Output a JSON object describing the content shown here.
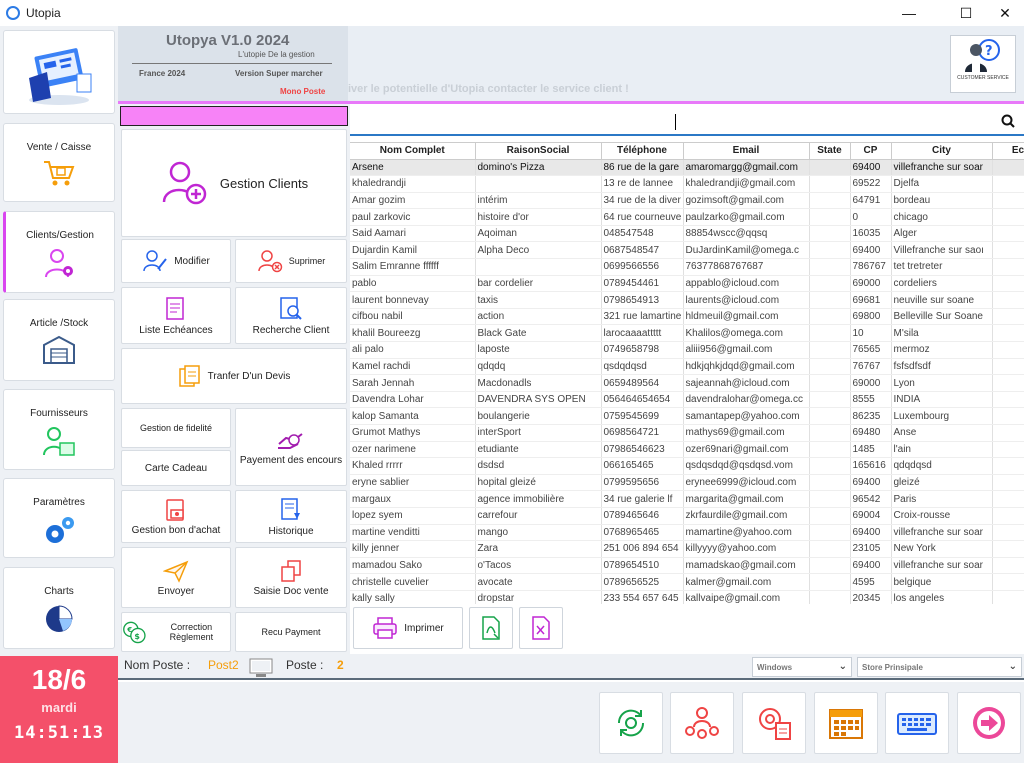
{
  "window": {
    "title": "Utopia",
    "min": "—",
    "max": "☐",
    "close": "✕"
  },
  "sidebar": {
    "items": [
      {
        "label": "Vente / Caisse"
      },
      {
        "label": "Clients/Gestion"
      },
      {
        "label": "Article /Stock"
      },
      {
        "label": "Fournisseurs"
      },
      {
        "label": "Paramètres"
      },
      {
        "label": "Charts"
      }
    ]
  },
  "datebox": {
    "date": "18/6",
    "weekday": "mardi",
    "time": "14:51:13"
  },
  "brand": {
    "name": "Utopya V1.0 2024",
    "tagline": "L'utopie De la gestion",
    "country": "France 2024",
    "version": "Version Super marcher",
    "mode": "Mono Poste"
  },
  "marquee": "iver le potentielle d'Utopia contacter le service client !",
  "support": {
    "label": "CUSTOMER SERVICE"
  },
  "actions": {
    "gestion_clients": "Gestion Clients",
    "modifier": "Modifier",
    "supprimer": "Suprimer",
    "liste_echeances": "Liste Echéances",
    "recherche_client": "Recherche Client",
    "transfer_devis": "Tranfer D'un Devis",
    "gestion_fidelite": "Gestion de fidelité",
    "carte_cadeau": "Carte Cadeau",
    "payement_encours": "Payement des encours",
    "gestion_bon_achat": "Gestion bon d'achat",
    "historique": "Historique",
    "envoyer": "Envoyer",
    "saisie_doc_vente": "Saisie Doc vente",
    "correction_reglement": "Correction Règlement",
    "recu_payment": "Recu Payment"
  },
  "table": {
    "columns": [
      "Nom Complet",
      "RaisonSocial",
      "Téléphone",
      "Email",
      "State",
      "CP",
      "City",
      "Ech"
    ],
    "rows": [
      [
        "Arsene",
        "domino's Pizza",
        "86 rue de la gare",
        "amaromargg@gmail.com",
        "",
        "69400",
        "villefranche sur soar",
        ""
      ],
      [
        "khaledrandji",
        "",
        "13 re de lannee",
        "khaledrandji@gmail.com",
        "",
        "69522",
        "Djelfa",
        ""
      ],
      [
        "Amar gozim",
        "intérim",
        "34 rue de la diver",
        "gozimsoft@gmail.com",
        "",
        "64791",
        "bordeau",
        ""
      ],
      [
        "paul zarkovic",
        "histoire d'or",
        "64 rue courneuve",
        "paulzarko@gmail.com",
        "",
        "0",
        "chicago",
        ""
      ],
      [
        "Said Aamari",
        "Aqoiman",
        "048547548",
        "88854wscc@qqsq",
        "",
        "16035",
        "Alger",
        ""
      ],
      [
        "Dujardin Kamil",
        "Alpha Deco",
        "0687548547",
        "DuJardinKamil@omega.c",
        "",
        "69400",
        "Villefranche sur saoı",
        ""
      ],
      [
        "Salim Emranne ffffff",
        "",
        "0699566556",
        "76377868767687",
        "",
        "786767",
        "tet tretreter",
        ""
      ],
      [
        "pablo",
        "bar cordelier",
        "0789454461",
        "appablo@icloud.com",
        "",
        "69000",
        "cordeliers",
        ""
      ],
      [
        "laurent bonnevay",
        "taxis",
        "0798654913",
        "laurents@icloud.com",
        "",
        "69681",
        "neuville sur soane",
        ""
      ],
      [
        "cifbou nabil",
        "action",
        "321 rue lamartine",
        "hldmeuil@gmail.com",
        "",
        "69800",
        "Belleville Sur Soane",
        ""
      ],
      [
        "khalil Boureezg",
        "Black Gate",
        "larocaaaattttt",
        "Khalilos@omega.com",
        "",
        "10",
        "M'sila",
        ""
      ],
      [
        "ali palo",
        "laposte",
        "0749658798",
        "aliii956@gmail.com",
        "",
        "76565",
        "mermoz",
        ""
      ],
      [
        "Kamel rachdi",
        "qdqdq",
        "qsdqdqsd",
        "hdkjqhkjdqd@gmail.com",
        "",
        "76767",
        "fsfsdfsdf",
        ""
      ],
      [
        "Sarah Jennah",
        "Macdonadls",
        "0659489564",
        "sajeannah@icloud.com",
        "",
        "69000",
        "Lyon",
        ""
      ],
      [
        "Davendra Lohar",
        "DAVENDRA SYS OPEN",
        "056464654654",
        "davendralohar@omega.cc",
        "",
        "8555",
        "INDIA",
        ""
      ],
      [
        "kalop Samanta",
        "boulangerie",
        "0759545699",
        "samantapep@yahoo.com",
        "",
        "86235",
        "Luxembourg",
        ""
      ],
      [
        "Grumot Mathys",
        "interSport",
        "0698564721",
        "mathys69@gmail.com",
        "",
        "69480",
        "Anse",
        ""
      ],
      [
        "ozer narimene",
        "etudiante",
        "07986546623",
        "ozer69nari@gmail.com",
        "",
        "1485",
        "l'ain",
        ""
      ],
      [
        "Khaled rrrrr",
        "dsdsd",
        "066165465",
        "qsdqsdqd@qsdqsd.vom",
        "",
        "165616",
        "qdqdqsd",
        ""
      ],
      [
        "eryne sablier",
        "hopital gleizé",
        "0799595656",
        "erynee6999@icloud.com",
        "",
        "69400",
        "gleizé",
        ""
      ],
      [
        "margaux",
        "agence immobilière",
        "34 rue galerie lf",
        "margarita@gmail.com",
        "",
        "96542",
        "Paris",
        ""
      ],
      [
        "lopez syem",
        "carrefour",
        "0789465646",
        "zkrfaurdile@gmail.com",
        "",
        "69004",
        "Croix-rousse",
        ""
      ],
      [
        "martine venditti",
        "mango",
        "0768965465",
        "mamartine@yahoo.com",
        "",
        "69400",
        "villefranche sur soar",
        ""
      ],
      [
        "killy jenner",
        "Zara",
        "251 006 894 654",
        "killyyyy@yahoo.com",
        "",
        "23105",
        "New York",
        ""
      ],
      [
        "mamadou Sako",
        "o'Tacos",
        "0789654510",
        "mamadskao@gmail.com",
        "",
        "69400",
        "villefranche sur soar",
        ""
      ],
      [
        "christelle cuvelier",
        "avocate",
        "0789656525",
        "kalmer@gmail.com",
        "",
        "4595",
        "belgique",
        ""
      ],
      [
        "kally sally",
        "dropstar",
        "233 554 657 645",
        "kallvaipe@gmail.com",
        "",
        "20345",
        "los angeles",
        ""
      ]
    ]
  },
  "tools": {
    "imprimer": "Imprimer"
  },
  "status": {
    "nom_poste_label": "Nom Poste :",
    "nom_poste_value": "Post2",
    "poste_label": "Poste :",
    "poste_value": "2",
    "windows_select": "Windows",
    "store_select": "Store Prinsipale"
  },
  "colors": {
    "accent": "#e879f9",
    "brand_pink": "#f4506a",
    "icon_red": "#ef4444",
    "icon_green": "#22c55e",
    "icon_orange": "#f59e0b"
  }
}
